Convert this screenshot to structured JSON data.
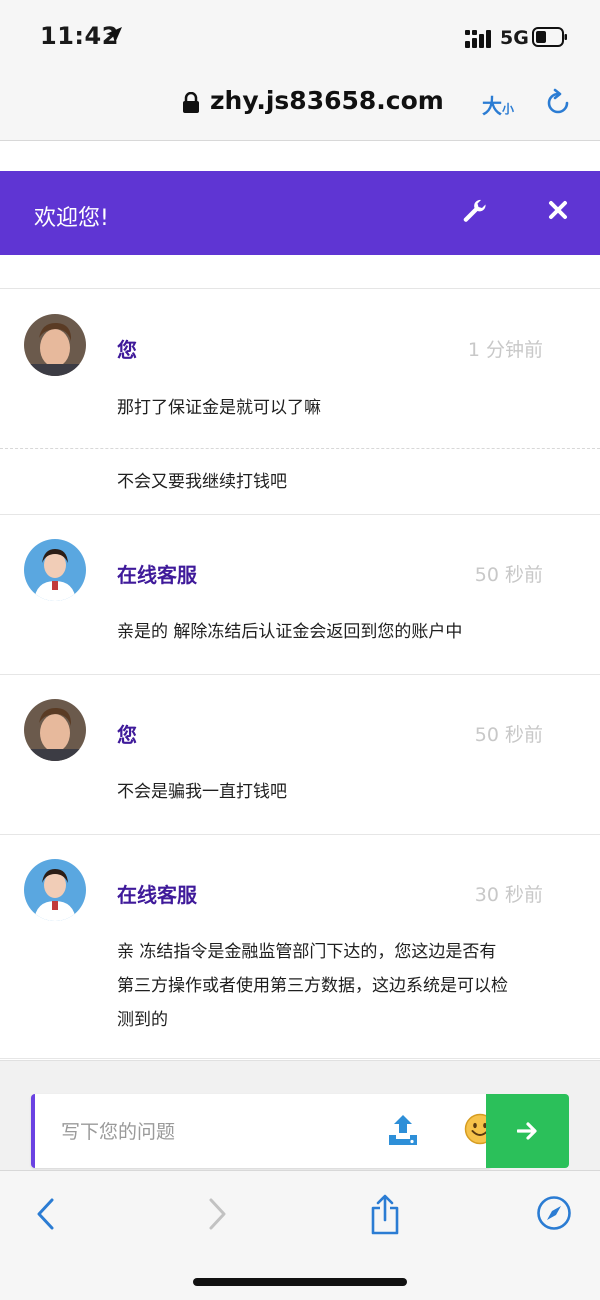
{
  "status_bar": {
    "time": "11:42",
    "network": "5G"
  },
  "browser": {
    "url": "zhy.js83658.com",
    "text_size_large": "大",
    "text_size_small": "小"
  },
  "banner": {
    "title": "欢迎您!"
  },
  "messages": [
    {
      "sender": "您",
      "time": "1 分钟前",
      "lines": [
        "那打了保证金是就可以了嘛"
      ],
      "follow_up": "不会又要我继续打钱吧"
    },
    {
      "sender": "在线客服",
      "time": "50 秒前",
      "lines": [
        "亲是的 解除冻结后认证金会返回到您的账户中"
      ]
    },
    {
      "sender": "您",
      "time": "50 秒前",
      "lines": [
        "不会是骗我一直打钱吧"
      ]
    },
    {
      "sender": "在线客服",
      "time": "30 秒前",
      "lines": [
        "亲 冻结指令是金融监管部门下达的，您这边是否有",
        "第三方操作或者使用第三方数据，这边系统是可以检",
        "测到的"
      ]
    }
  ],
  "composer": {
    "placeholder": "写下您的问题"
  },
  "colors": {
    "banner": "#5f35d3",
    "sender": "#3f1a9a",
    "send_button": "#2bc05a",
    "browser_accent": "#2b7cd3"
  }
}
